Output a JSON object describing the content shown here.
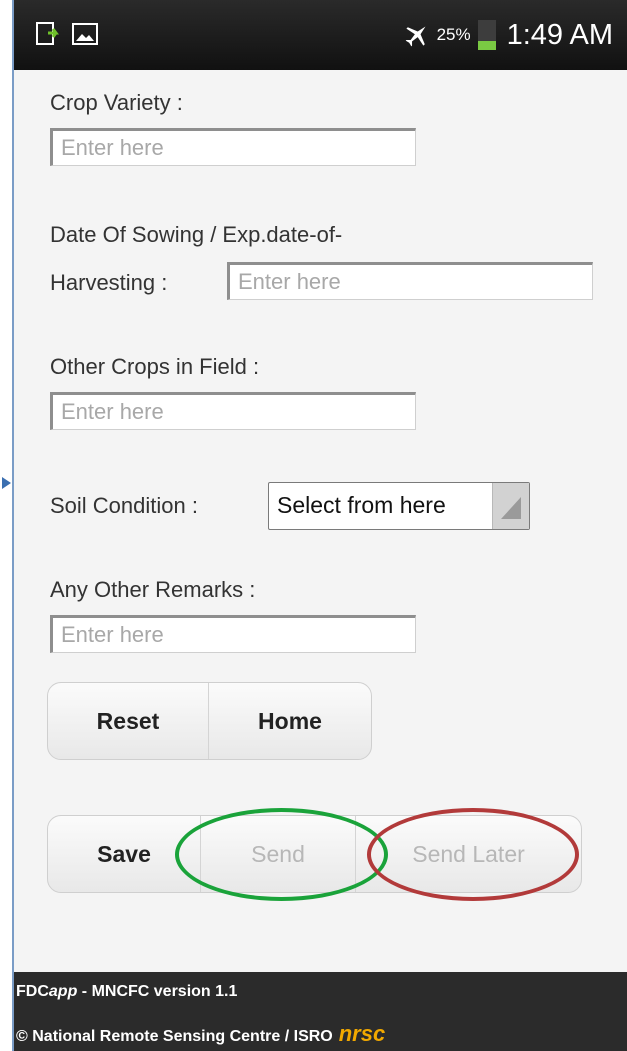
{
  "status_bar": {
    "icons": [
      "download-icon",
      "image-icon",
      "airplane-mode-icon",
      "battery-icon"
    ],
    "battery_percent": "25%",
    "time": "1:49 AM"
  },
  "form": {
    "crop_variety": {
      "label": "Crop Variety :",
      "placeholder": "Enter here"
    },
    "date_of_sowing": {
      "label_line1": "Date Of Sowing / Exp.date-of-",
      "label_line2": "Harvesting :",
      "placeholder": "Enter here"
    },
    "other_crops": {
      "label": "Other Crops in Field :",
      "placeholder": "Enter here"
    },
    "soil_condition": {
      "label": "Soil Condition :",
      "selected": "Select from here"
    },
    "other_remarks": {
      "label": "Any Other Remarks :",
      "placeholder": "Enter here"
    }
  },
  "buttons": {
    "reset": "Reset",
    "home": "Home",
    "save": "Save",
    "send": "Send",
    "send_later": "Send Later"
  },
  "footer": {
    "app_prefix": "FDC",
    "app_italic": "app",
    "version_text": " - MNCFC version 1.1",
    "copyright": "© National Remote Sensing Centre / ISRO",
    "logo": "nrsc"
  },
  "colors": {
    "send_ring": "#1aa33a",
    "send_later_ring": "#b23a3a",
    "logo": "#f2a900"
  }
}
